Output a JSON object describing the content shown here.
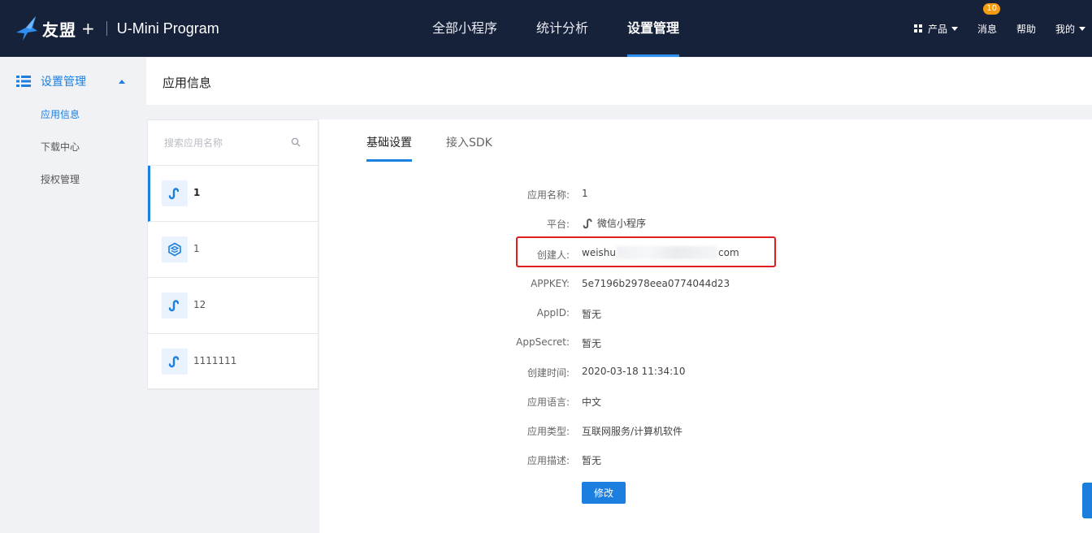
{
  "brand": {
    "name_cn": "友盟",
    "plus": "+",
    "product": "U-Mini Program"
  },
  "colors": {
    "topbar": "#16213a",
    "accent": "#1c7fe0",
    "badge": "#f39c12",
    "highlight": "#e02020"
  },
  "nav": {
    "items": [
      {
        "label": "全部小程序"
      },
      {
        "label": "统计分析"
      },
      {
        "label": "设置管理",
        "active": true
      }
    ]
  },
  "header_right": {
    "products": "产品",
    "messages": "消息",
    "message_count": "10",
    "help": "帮助",
    "mine": "我的"
  },
  "sidebar": {
    "section": "设置管理",
    "items": [
      {
        "label": "应用信息",
        "active": true
      },
      {
        "label": "下载中心"
      },
      {
        "label": "授权管理"
      }
    ]
  },
  "page": {
    "title": "应用信息"
  },
  "app_list": {
    "search_placeholder": "搜索应用名称",
    "apps": [
      {
        "name": "1",
        "icon": "wechat-miniprogram-icon",
        "active": true
      },
      {
        "name": "1",
        "icon": "cube-app-icon"
      },
      {
        "name": "12",
        "icon": "wechat-miniprogram-icon"
      },
      {
        "name": "1111111",
        "icon": "wechat-miniprogram-icon"
      }
    ]
  },
  "tabs": [
    {
      "label": "基础设置",
      "active": true
    },
    {
      "label": "接入SDK"
    }
  ],
  "details": {
    "app_name": {
      "label": "应用名称:",
      "value": "1"
    },
    "platform": {
      "label": "平台:",
      "value": "微信小程序"
    },
    "creator": {
      "label": "创建人:",
      "value_prefix": "weishu",
      "value_suffix": "com"
    },
    "appkey": {
      "label": "APPKEY:",
      "value": "5e7196b2978eea0774044d23"
    },
    "appid": {
      "label": "AppID:",
      "value": "暂无"
    },
    "appsecret": {
      "label": "AppSecret:",
      "value": "暂无"
    },
    "created_at": {
      "label": "创建时间:",
      "value": "2020-03-18 11:34:10"
    },
    "language": {
      "label": "应用语言:",
      "value": "中文"
    },
    "category": {
      "label": "应用类型:",
      "value": "互联网服务/计算机软件"
    },
    "description": {
      "label": "应用描述:",
      "value": "暂无"
    }
  },
  "edit_button": "修改"
}
